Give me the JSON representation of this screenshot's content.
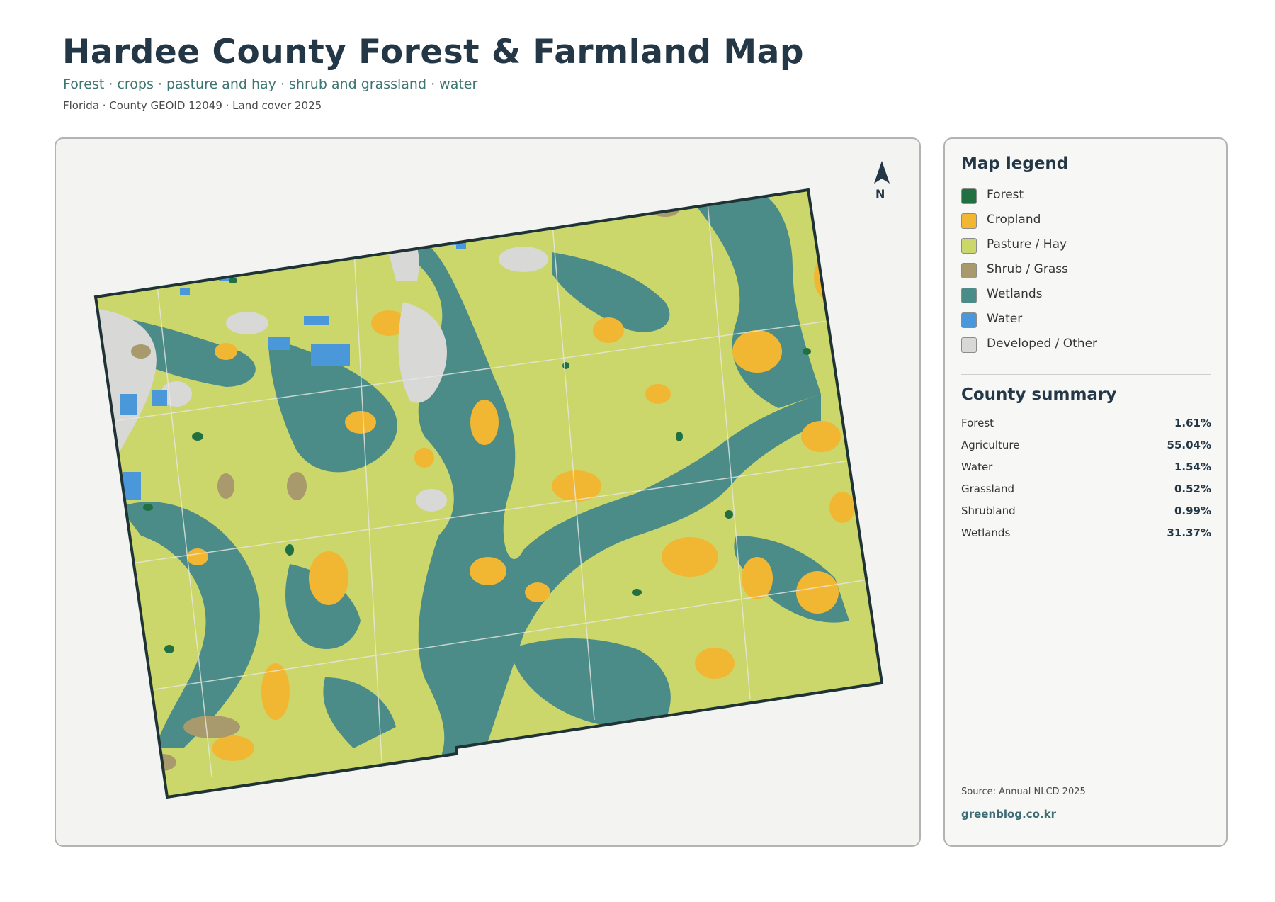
{
  "header": {
    "title": "Hardee County Forest & Farmland Map",
    "subtitle": "Forest · crops · pasture and hay · shrub and grassland · water",
    "meta": "Florida · County GEOID 12049 · Land cover 2025"
  },
  "map": {
    "north_label": "N",
    "colors": {
      "forest": "#217041",
      "cropland": "#f1b733",
      "pasture": "#cbd66b",
      "shrub": "#a89a6c",
      "wetlands": "#4b8c88",
      "water": "#4a98da",
      "developed": "#d8d8d6",
      "boundary": "#1f3336"
    }
  },
  "legend": {
    "title": "Map legend",
    "items": [
      {
        "label": "Forest",
        "color": "#217041"
      },
      {
        "label": "Cropland",
        "color": "#f1b733"
      },
      {
        "label": "Pasture / Hay",
        "color": "#cbd66b"
      },
      {
        "label": "Shrub / Grass",
        "color": "#a89a6c"
      },
      {
        "label": "Wetlands",
        "color": "#4b8c88"
      },
      {
        "label": "Water",
        "color": "#4a98da"
      },
      {
        "label": "Developed / Other",
        "color": "#d8d8d6"
      }
    ]
  },
  "summary": {
    "title": "County summary",
    "rows": [
      {
        "label": "Forest",
        "value": "1.61%"
      },
      {
        "label": "Agriculture",
        "value": "55.04%"
      },
      {
        "label": "Water",
        "value": "1.54%"
      },
      {
        "label": "Grassland",
        "value": "0.52%"
      },
      {
        "label": "Shrubland",
        "value": "0.99%"
      },
      {
        "label": "Wetlands",
        "value": "31.37%"
      }
    ]
  },
  "footer": {
    "source": "Source: Annual NLCD 2025",
    "site": "greenblog.co.kr"
  }
}
